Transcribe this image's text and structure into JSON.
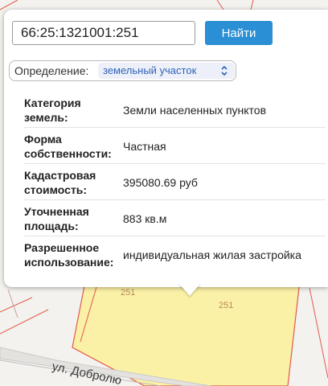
{
  "search": {
    "value": "66:25:1321001:251",
    "button_label": "Найти"
  },
  "definition": {
    "label": "Определение:",
    "selected": "земельный участок"
  },
  "info_rows": [
    {
      "label_lines": [
        "Категория",
        "земель:"
      ],
      "value": "Земли населенных пунктов"
    },
    {
      "label_lines": [
        "Форма",
        "собственности:"
      ],
      "value": "Частная"
    },
    {
      "label_lines": [
        "Кадастровая",
        "стоимость:"
      ],
      "value": "395080.69 руб"
    },
    {
      "label_lines": [
        "Уточненная",
        "площадь:"
      ],
      "value": "883 кв.м"
    },
    {
      "label_lines": [
        "Разрешенное",
        "использование:"
      ],
      "value": "индивидуальная жилая застройка"
    }
  ],
  "map": {
    "parcel_labels": [
      "251",
      "251"
    ],
    "street_label": "ул. Добролю",
    "colors": {
      "parcel_fill": "#faf0a6",
      "parcel_border": "#e25a4a",
      "road": "#c9c9c9",
      "background": "#f4f2ee"
    }
  },
  "colors": {
    "button": "#2a8fd4",
    "select_text": "#2e62b8"
  }
}
